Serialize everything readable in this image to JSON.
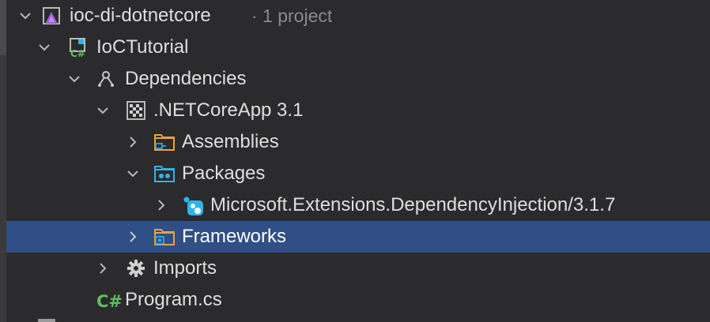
{
  "tree": {
    "solution": {
      "name": "ioc-di-dotnetcore",
      "hint": "· 1 project",
      "icon": "solution-icon"
    },
    "project": {
      "name": "IoCTutorial",
      "icon": "csharp-project-icon"
    },
    "dependencies": {
      "name": "Dependencies",
      "icon": "dependencies-icon"
    },
    "framework": {
      "name": ".NETCoreApp 3.1",
      "icon": "framework-target-icon"
    },
    "assemblies": {
      "name": "Assemblies",
      "icon": "assemblies-folder-icon"
    },
    "packages": {
      "name": "Packages",
      "icon": "packages-folder-icon"
    },
    "package": {
      "name": "Microsoft.Extensions.DependencyInjection/3.1.7",
      "icon": "nuget-package-icon"
    },
    "frameworks": {
      "name": "Frameworks",
      "icon": "frameworks-folder-icon",
      "selected": true
    },
    "imports": {
      "name": "Imports",
      "icon": "gear-icon"
    },
    "program": {
      "name": "Program.cs",
      "icon": "csharp-file-icon",
      "badge": "C#"
    }
  },
  "colors": {
    "background": "#2b2b2d",
    "selection": "#2f4f86",
    "folder_orange": "#e8a33d",
    "package_blue": "#2fb4e8",
    "csharp_green": "#5fbf5f",
    "solution_purple": "#a05bd6"
  }
}
